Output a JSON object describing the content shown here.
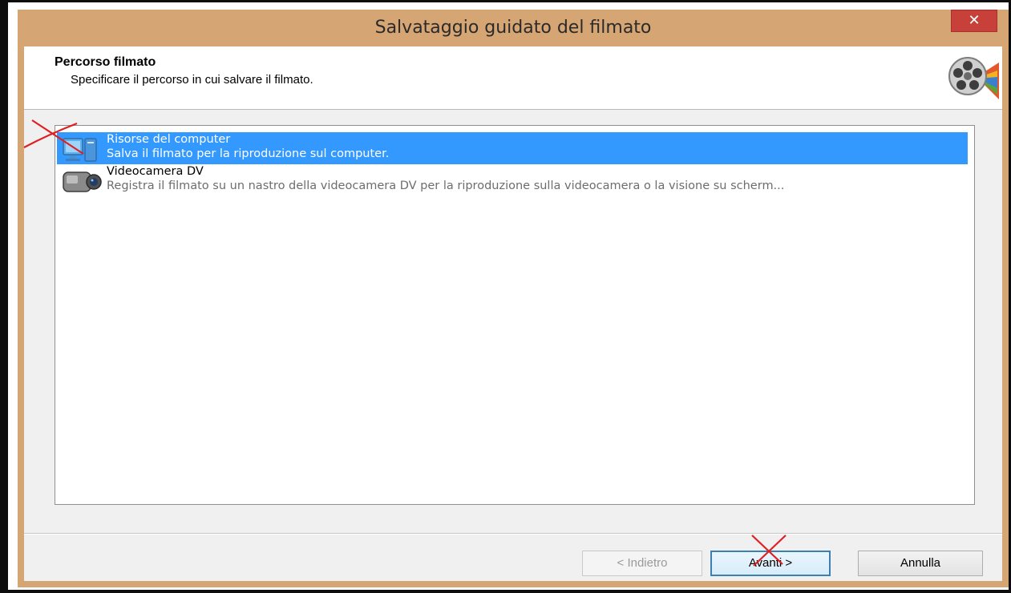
{
  "window": {
    "title": "Salvataggio guidato del filmato",
    "close_glyph": "✕"
  },
  "header": {
    "title": "Percorso filmato",
    "subtitle": "Specificare il percorso in cui salvare il filmato.",
    "icon": "film-reel-icon"
  },
  "list": {
    "items": [
      {
        "title": "Risorse del computer",
        "description": "Salva il filmato per la riproduzione sul computer.",
        "icon": "computer-icon",
        "selected": true
      },
      {
        "title": "Videocamera DV",
        "description": "Registra il filmato su un nastro della videocamera DV per la riproduzione sulla videocamera o la visione su scherm...",
        "icon": "camcorder-icon",
        "selected": false
      }
    ]
  },
  "buttons": {
    "back": "< Indietro",
    "next": "Avanti >",
    "cancel": "Annulla"
  },
  "colors": {
    "frame": "#d6a574",
    "selection": "#3399ff",
    "close": "#c7403a",
    "annotation": "#e02020"
  }
}
